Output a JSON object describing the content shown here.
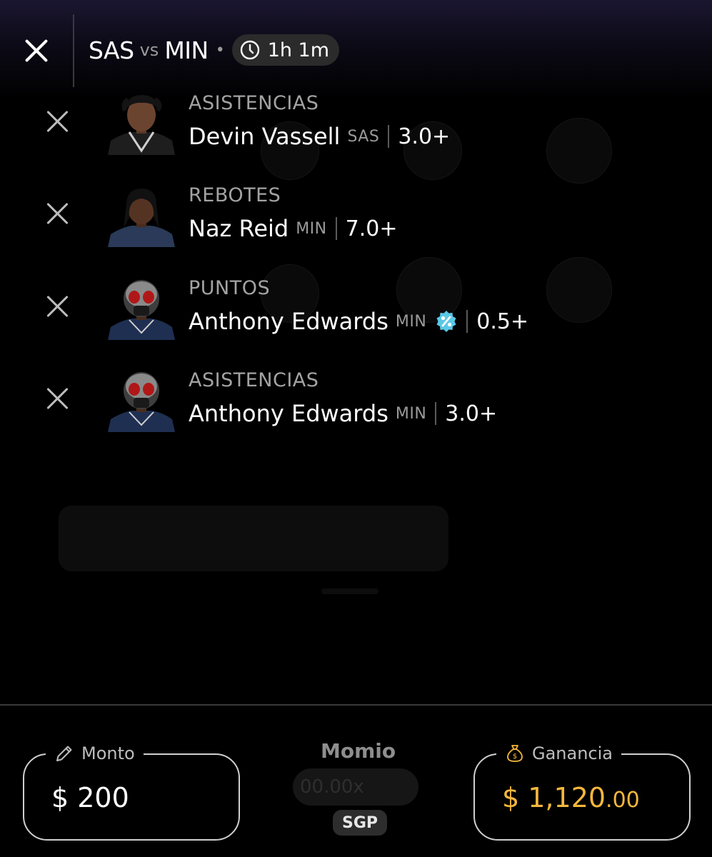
{
  "header": {
    "home_team": "SAS",
    "vs": "vs",
    "away_team": "MIN",
    "separator": "•",
    "time_left": "1h 1m"
  },
  "picks": [
    {
      "market": "ASISTENCIAS",
      "player": "Devin Vassell",
      "team": "SAS",
      "value": "3.0+",
      "boosted": false
    },
    {
      "market": "REBOTES",
      "player": "Naz Reid",
      "team": "MIN",
      "value": "7.0+",
      "boosted": false
    },
    {
      "market": "PUNTOS",
      "player": "Anthony Edwards",
      "team": "MIN",
      "value": "0.5+",
      "boosted": true
    },
    {
      "market": "ASISTENCIAS",
      "player": "Anthony Edwards",
      "team": "MIN",
      "value": "3.0+",
      "boosted": false
    }
  ],
  "bet_slip": {
    "amount_label": "Monto",
    "amount_value": "$ 200",
    "odds_label": "Momio",
    "odds_placeholder": "00.00x",
    "odds_badge": "SGP",
    "payout_label": "Ganancia",
    "payout_value_main": "$ 1,120",
    "payout_value_cents": ".00"
  },
  "colors": {
    "background": "#000000",
    "accent_gold": "#f4b73c",
    "boost_icon": "#5bc8e6",
    "muted_text": "#a3a3a3"
  }
}
